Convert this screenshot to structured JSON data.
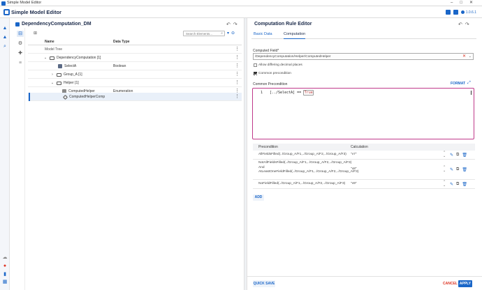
{
  "window": {
    "title": "Simple Model Editor"
  },
  "app": {
    "name": "Simple Model Editor",
    "version": "1.0.6.1"
  },
  "model": {
    "title": "DependencyComputation_DM",
    "search_placeholder": "Search Elements...",
    "columns": {
      "name": "Name",
      "type": "Data Type"
    },
    "root_label": "Model Tree",
    "rows": [
      {
        "label": "DependencyComputation [1]",
        "type": ""
      },
      {
        "label": "SelectA",
        "type": "Boolean"
      },
      {
        "label": "Group_A [1]",
        "type": ""
      },
      {
        "label": "Helper [1]",
        "type": ""
      },
      {
        "label": "ComputedHelper",
        "type": "Enumeration"
      },
      {
        "label": "ComputedHelperComp",
        "type": ""
      }
    ]
  },
  "editor": {
    "title": "Computation Rule Editor",
    "tabs": [
      "Basic Data",
      "Computation"
    ],
    "computed_field_label": "Computed Field*",
    "computed_field_value": "/DependencyComputation/Helper/ComputedHelper",
    "allow_decimal_label": "Allow differing decimal places",
    "common_precondition_checkbox": "Common precondition",
    "common_precondition_label": "Common Precondition",
    "format_label": "FORMAT",
    "code_line_number": "1",
    "code_prefix": "[../SelectA] == ",
    "code_keyword": "True",
    "table": {
      "col_precondition": "Precondition",
      "col_calculation": "Calculation",
      "rows": [
        {
          "precondition": "AllFieldsFilled(../Group_A/F1,../Group_A/F2,../Group_A/F3)",
          "calculation": "\"v7\""
        },
        {
          "precondition": "NotAllFieldsFilled(../Group_A/F1,../Group_A/F2,../Group_A/F3) And AtLeastOneFieldFilled(../Group_A/F1,../Group_A/F2,../Group_A/F3)",
          "calculation": "\"v8\""
        },
        {
          "precondition": "NoFieldFilled(../Group_A/F1,../Group_A/F2,../Group_A/F3)",
          "calculation": "\"v9\""
        }
      ]
    },
    "add_label": "ADD",
    "quick_save_label": "QUICK SAVE",
    "cancel_label": "CANCEL",
    "apply_label": "APPLY"
  }
}
